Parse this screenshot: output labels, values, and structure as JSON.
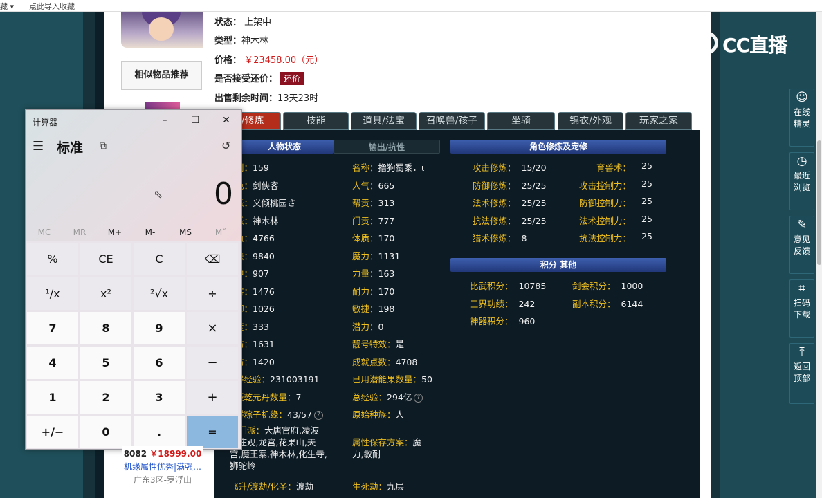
{
  "browser": {
    "left_text": "藏 ▾",
    "bookmark_hint": "点此导入收藏"
  },
  "listing": {
    "status_label": "状态：",
    "status_value": "上架中",
    "type_label": "类型：",
    "type_value": "神木林",
    "price_label": "价格：",
    "price_value": "￥23458.00（元）",
    "counter_label": "是否接受还价：",
    "counter_button": "还价",
    "time_label": "出售剩余时间：",
    "time_value": "13天23时",
    "similar_title": "相似物品推荐"
  },
  "tabs": [
    "物/修炼",
    "技能",
    "道具/法宝",
    "召唤兽/孩子",
    "坐骑",
    "锦衣/外观",
    "玩家之家"
  ],
  "panel": {
    "char_tab": "人物状态",
    "output_tab": "输出/抗性",
    "cultivation_title": "角色修炼及宠修",
    "score_title": "积分 其他"
  },
  "left_stats": [
    {
      "k": "别：",
      "v": "159"
    },
    {
      "k": "色：",
      "v": "剑侠客"
    },
    {
      "k": "派：",
      "v": "义倾桃园さ"
    },
    {
      "k": "派：",
      "v": "神木林"
    },
    {
      "k": "血：",
      "v": "4766"
    },
    {
      "k": "法：",
      "v": "9840"
    },
    {
      "k": "中：",
      "v": "907"
    },
    {
      "k": "害：",
      "v": "1476"
    },
    {
      "k": "御：",
      "v": "1026"
    },
    {
      "k": "度：",
      "v": "333"
    },
    {
      "k": "防：",
      "v": "1631"
    },
    {
      "k": "防：",
      "v": "1420"
    },
    {
      "k": "得经验：",
      "v": "231003191"
    },
    {
      "k": "版乾元丹数量：",
      "v": "7"
    },
    {
      "k": "拼粽子机缘：",
      "v": "43/57"
    }
  ],
  "history": {
    "k": "史门派：",
    "v1": "大唐官府,凌波",
    "v2": "五庄观,龙宫,花果山,天",
    "v3": "宫,魔王寨,神木林,化生寺,",
    "v4": "狮驼岭"
  },
  "ascend": {
    "k": "飞升/渡劫/化圣：",
    "v": "渡劫"
  },
  "mid_stats": [
    {
      "k": "名称：",
      "v": "撸狗蜀黍．ι"
    },
    {
      "k": "人气：",
      "v": "665"
    },
    {
      "k": "帮贡：",
      "v": "313"
    },
    {
      "k": "门贡：",
      "v": "777"
    },
    {
      "k": "体质：",
      "v": "170"
    },
    {
      "k": "魔力：",
      "v": "1131"
    },
    {
      "k": "力量：",
      "v": "163"
    },
    {
      "k": "耐力：",
      "v": "170"
    },
    {
      "k": "敏捷：",
      "v": "198"
    },
    {
      "k": "潜力：",
      "v": "0"
    },
    {
      "k": "靓号特效：",
      "v": "是"
    },
    {
      "k": "成就点数：",
      "v": "4708"
    },
    {
      "k": "已用潜能果数量：",
      "v": "50"
    },
    {
      "k": "总经验：",
      "v": "294亿"
    },
    {
      "k": "原始种族：",
      "v": "人"
    }
  ],
  "attr_plan": {
    "k": "属性保存方案：",
    "v1": "魔",
    "v2": "力,敏耐"
  },
  "life_death": {
    "k": "生死劫：",
    "v": "九层"
  },
  "cultivation": [
    {
      "k": "攻击修炼：",
      "v": "15/20",
      "k2": "育兽术：",
      "v2": "25"
    },
    {
      "k": "防御修炼：",
      "v": "25/25",
      "k2": "攻击控制力：",
      "v2": "25"
    },
    {
      "k": "法术修炼：",
      "v": "25/25",
      "k2": "防御控制力：",
      "v2": "25"
    },
    {
      "k": "抗法修炼：",
      "v": "25/25",
      "k2": "法术控制力：",
      "v2": "25"
    },
    {
      "k": "猎术修炼：",
      "v": "8",
      "k2": "抗法控制力：",
      "v2": "25"
    }
  ],
  "scores": [
    {
      "k": "比武积分：",
      "v": "10785",
      "k2": "剑会积分：",
      "v2": "1000"
    },
    {
      "k": "三界功绩：",
      "v": "242",
      "k2": "副本积分：",
      "v2": "6144"
    },
    {
      "k": "神器积分：",
      "v": "960",
      "k2": "",
      "v2": ""
    }
  ],
  "calculator": {
    "title": "计算器",
    "mode": "标准",
    "display": "0",
    "memory": [
      "MC",
      "MR",
      "M+",
      "M-",
      "MS",
      "M˅"
    ],
    "keys": [
      [
        "%",
        "CE",
        "C",
        "⌫"
      ],
      [
        "¹/x",
        "x²",
        "²√x",
        "÷"
      ],
      [
        "7",
        "8",
        "9",
        "×"
      ],
      [
        "4",
        "5",
        "6",
        "−"
      ],
      [
        "1",
        "2",
        "3",
        "+"
      ],
      [
        "+/−",
        "0",
        ".",
        "="
      ]
    ]
  },
  "bottom_card": {
    "price_id": "8082",
    "price": "￥18999.00",
    "desc": "机缘属性优秀|满强…",
    "server": "广东3区-罗浮山"
  },
  "stream": {
    "logo": "CC直播"
  },
  "side_tools": [
    {
      "icon": "avatar-icon",
      "l1": "在线",
      "l2": "精灵"
    },
    {
      "icon": "clock-icon",
      "l1": "最近",
      "l2": "浏览"
    },
    {
      "icon": "edit-icon",
      "l1": "意见",
      "l2": "反馈"
    },
    {
      "icon": "scan-icon",
      "l1": "扫码",
      "l2": "下载"
    },
    {
      "icon": "top-icon",
      "l1": "返回",
      "l2": "顶部"
    }
  ]
}
